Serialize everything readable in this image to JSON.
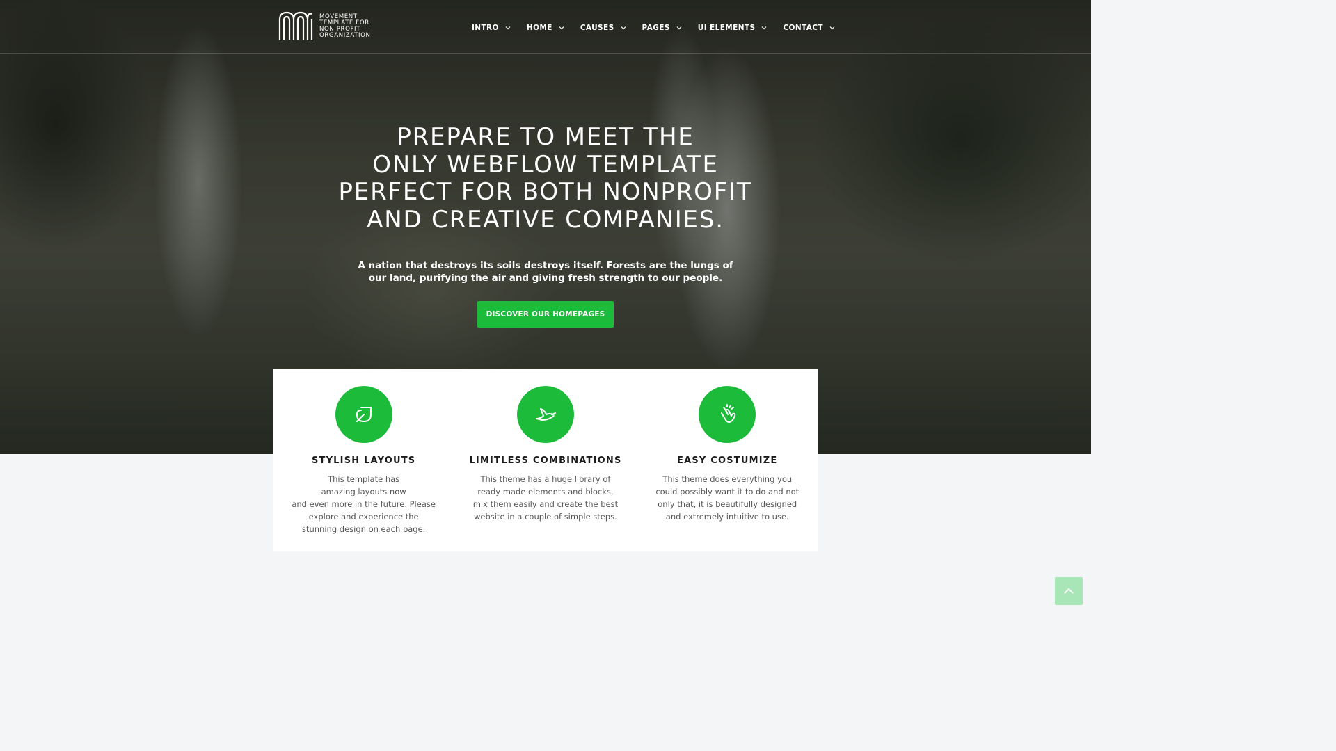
{
  "header": {
    "logo_text": "MOVEMENT\nTEMPLATE FOR\nNON PROFIT\nORGANIZATION",
    "nav": [
      {
        "label": "INTRO"
      },
      {
        "label": "HOME"
      },
      {
        "label": "CAUSES"
      },
      {
        "label": "PAGES"
      },
      {
        "label": "UI ELEMENTS"
      },
      {
        "label": "CONTACT"
      }
    ]
  },
  "hero": {
    "title": "PREPARE TO MEET THE\nONLY WEBFLOW TEMPLATE\nPERFECT FOR BOTH NONPROFIT\nAND CREATIVE COMPANIES.",
    "subtitle": "A nation that destroys its soils destroys itself. Forests are the lungs of\nour land, purifying the air and giving fresh strength to our people.",
    "cta_label": "DISCOVER OUR HOMEPAGES"
  },
  "features": [
    {
      "icon": "leaf-icon",
      "title": "STYLISH LAYOUTS",
      "text": "This template has\namazing layouts now\nand even more in the future. Please\nexplore and experience the\nstunning design on each page."
    },
    {
      "icon": "dove-icon",
      "title": "LIMITLESS COMBINATIONS",
      "text": "This theme has a huge library of\nready made elements and blocks,\nmix them easily and create the best\nwebsite in a couple of simple steps."
    },
    {
      "icon": "finger-snap-icon",
      "title": "EASY COSTUMIZE",
      "text": "This theme does everything you\ncould possibly want it to do and not\nonly that, it is beautifully designed\nand extremely intuitive to use."
    }
  ],
  "colors": {
    "accent": "#1dbb3a",
    "back_to_top": "#a8e6b7"
  },
  "back_to_top_icon": "chevron-up-icon"
}
